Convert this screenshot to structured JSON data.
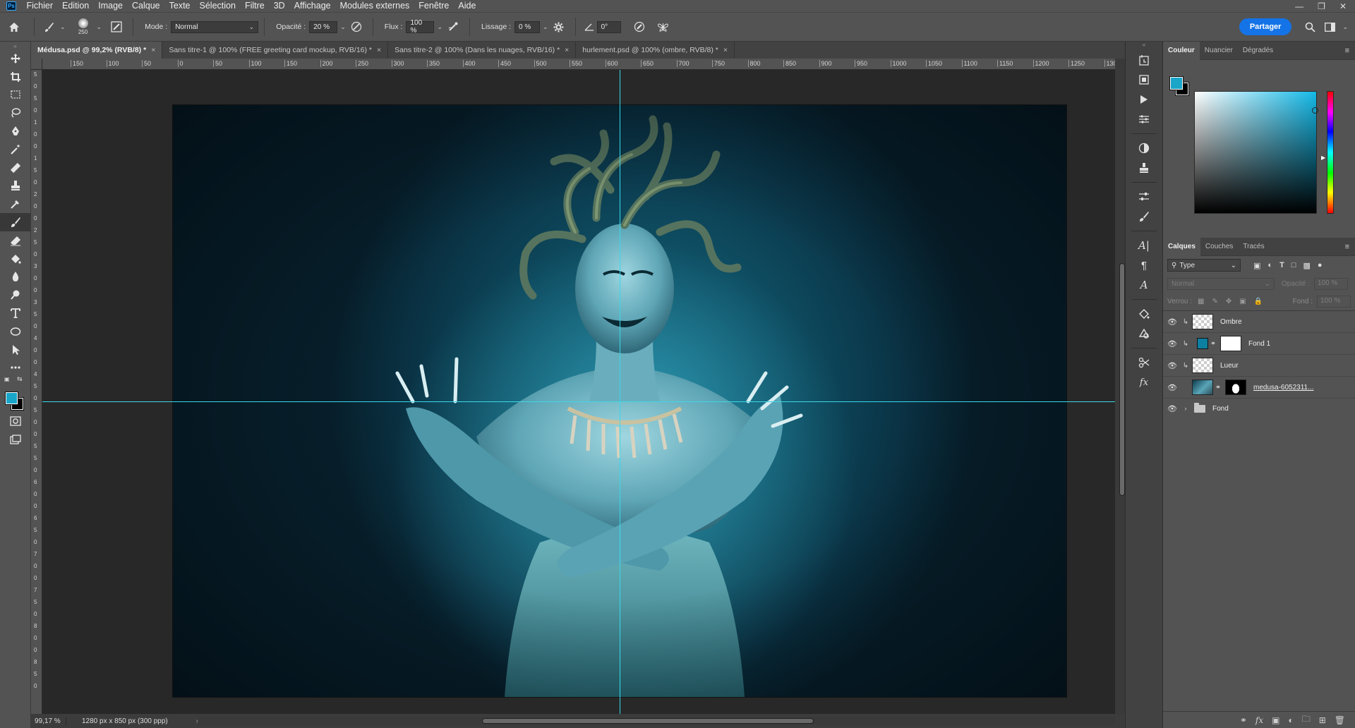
{
  "menubar": {
    "logo": "Ps",
    "items": [
      "Fichier",
      "Edition",
      "Image",
      "Calque",
      "Texte",
      "Sélection",
      "Filtre",
      "3D",
      "Affichage",
      "Modules externes",
      "Fenêtre",
      "Aide"
    ]
  },
  "options": {
    "brush_size": "250",
    "mode_label": "Mode :",
    "mode_value": "Normal",
    "opacity_label": "Opacité :",
    "opacity_value": "20 %",
    "flow_label": "Flux :",
    "flow_value": "100 %",
    "smoothing_label": "Lissage :",
    "smoothing_value": "0 %",
    "angle_value": "0°",
    "share_label": "Partager"
  },
  "tabs": [
    {
      "label": "Médusa.psd @ 99,2% (RVB/8) *",
      "active": true
    },
    {
      "label": "Sans titre-1 @ 100% (FREE greeting card mockup, RVB/16) *"
    },
    {
      "label": "Sans titre-2 @ 100% (Dans les nuages, RVB/16) *"
    },
    {
      "label": "hurlement.psd @ 100% (ombre, RVB/8) *"
    }
  ],
  "ruler_h": [
    "150",
    "100",
    "50",
    "0",
    "50",
    "100",
    "150",
    "200",
    "250",
    "300",
    "350",
    "400",
    "450",
    "500",
    "550",
    "600",
    "650",
    "700",
    "750",
    "800",
    "850",
    "900",
    "950",
    "1000",
    "1050",
    "1100",
    "1150",
    "1200",
    "1250",
    "1300",
    "13"
  ],
  "ruler_v": [
    "5",
    "0",
    "5",
    "0",
    "1",
    "0",
    "0",
    "1",
    "5",
    "0",
    "2",
    "0",
    "0",
    "2",
    "5",
    "0",
    "3",
    "0",
    "0",
    "3",
    "5",
    "0",
    "4",
    "0",
    "0",
    "4",
    "5",
    "0",
    "5",
    "0",
    "0",
    "5",
    "5",
    "0",
    "6",
    "0",
    "0",
    "6",
    "5",
    "0",
    "7",
    "0",
    "0",
    "7",
    "5",
    "0",
    "8",
    "0",
    "0",
    "8",
    "5",
    "0"
  ],
  "status": {
    "zoom": "99,17 %",
    "doc_info": "1280 px x 850 px (300 ppp)"
  },
  "color_panel": {
    "tabs": [
      "Couleur",
      "Nuancier",
      "Dégradés"
    ],
    "fg_color": "#1aa6c9",
    "bg_color": "#000000"
  },
  "layers_panel": {
    "tabs": [
      "Calques",
      "Couches",
      "Tracés"
    ],
    "filter_value": "Type",
    "mode_value": "Normal",
    "opacity_label": "Opacité :",
    "opacity_value": "100 %",
    "lock_label": "Verrou :",
    "fill_label": "Fond :",
    "fill_value": "100 %",
    "layers": [
      {
        "name": "Ombre"
      },
      {
        "name": "Fond 1"
      },
      {
        "name": "Lueur"
      },
      {
        "name": "medusa-6052311..."
      },
      {
        "name": "Fond"
      }
    ]
  },
  "colors": {
    "accent": "#1473e6",
    "guide": "#3ad8ea"
  }
}
